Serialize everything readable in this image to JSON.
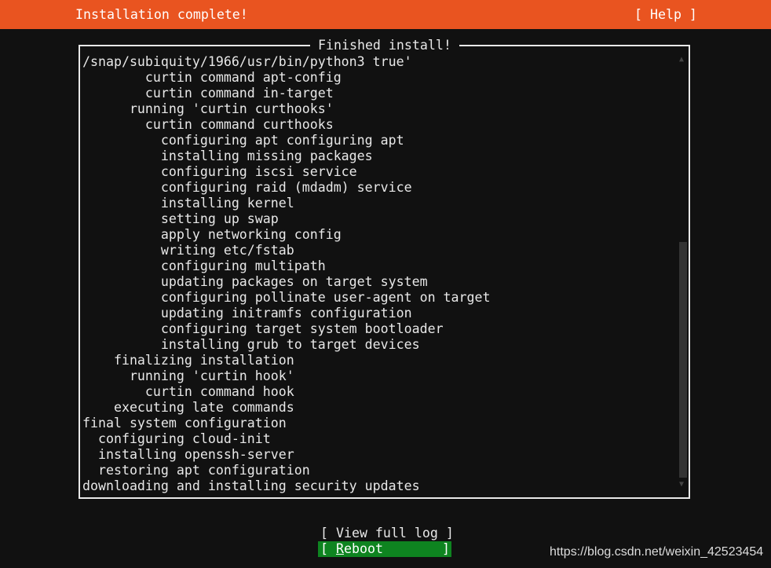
{
  "header": {
    "title": "Installation complete!",
    "help_label": "[ Help ]",
    "color": "#E95420"
  },
  "dialog": {
    "title": "Finished install!",
    "log_lines": [
      "/snap/subiquity/1966/usr/bin/python3 true'",
      "        curtin command apt-config",
      "        curtin command in-target",
      "      running 'curtin curthooks'",
      "        curtin command curthooks",
      "          configuring apt configuring apt",
      "          installing missing packages",
      "          configuring iscsi service",
      "          configuring raid (mdadm) service",
      "          installing kernel",
      "          setting up swap",
      "          apply networking config",
      "          writing etc/fstab",
      "          configuring multipath",
      "          updating packages on target system",
      "          configuring pollinate user-agent on target",
      "          updating initramfs configuration",
      "          configuring target system bootloader",
      "          installing grub to target devices",
      "    finalizing installation",
      "      running 'curtin hook'",
      "        curtin command hook",
      "    executing late commands",
      "final system configuration",
      "  configuring cloud-init",
      "  installing openssh-server",
      "  restoring apt configuration",
      "downloading and installing security updates"
    ],
    "scroll_position": 1.0
  },
  "buttons": {
    "view_log": "[ View full log ]",
    "reboot_open": "[ ",
    "reboot_hotkey": "R",
    "reboot_rest": "eboot",
    "reboot_close": "]",
    "reboot_color": "#0E8420"
  },
  "watermark": "https://blog.csdn.net/weixin_42523454"
}
